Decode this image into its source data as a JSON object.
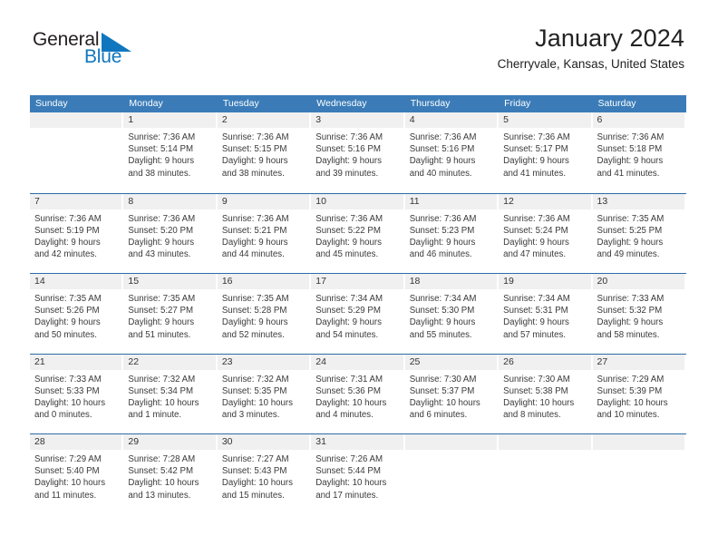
{
  "brand": {
    "name_part1": "General",
    "name_part2": "Blue",
    "triangle_icon": "triangle-icon",
    "colors": {
      "dark": "#231f20",
      "blue": "#1077bf"
    }
  },
  "header": {
    "title": "January 2024",
    "subtitle": "Cherryvale, Kansas, United States"
  },
  "theme": {
    "header_blue": "#3b7cb8",
    "row_border_blue": "#2c6ca8",
    "day_band_gray": "#f0f0f0"
  },
  "weekdays": [
    "Sunday",
    "Monday",
    "Tuesday",
    "Wednesday",
    "Thursday",
    "Friday",
    "Saturday"
  ],
  "weeks": [
    [
      {
        "day": "",
        "sunrise": "",
        "sunset": "",
        "daylight_line1": "",
        "daylight_line2": "",
        "empty": true
      },
      {
        "day": "1",
        "sunrise": "Sunrise: 7:36 AM",
        "sunset": "Sunset: 5:14 PM",
        "daylight_line1": "Daylight: 9 hours",
        "daylight_line2": "and 38 minutes."
      },
      {
        "day": "2",
        "sunrise": "Sunrise: 7:36 AM",
        "sunset": "Sunset: 5:15 PM",
        "daylight_line1": "Daylight: 9 hours",
        "daylight_line2": "and 38 minutes."
      },
      {
        "day": "3",
        "sunrise": "Sunrise: 7:36 AM",
        "sunset": "Sunset: 5:16 PM",
        "daylight_line1": "Daylight: 9 hours",
        "daylight_line2": "and 39 minutes."
      },
      {
        "day": "4",
        "sunrise": "Sunrise: 7:36 AM",
        "sunset": "Sunset: 5:16 PM",
        "daylight_line1": "Daylight: 9 hours",
        "daylight_line2": "and 40 minutes."
      },
      {
        "day": "5",
        "sunrise": "Sunrise: 7:36 AM",
        "sunset": "Sunset: 5:17 PM",
        "daylight_line1": "Daylight: 9 hours",
        "daylight_line2": "and 41 minutes."
      },
      {
        "day": "6",
        "sunrise": "Sunrise: 7:36 AM",
        "sunset": "Sunset: 5:18 PM",
        "daylight_line1": "Daylight: 9 hours",
        "daylight_line2": "and 41 minutes."
      }
    ],
    [
      {
        "day": "7",
        "sunrise": "Sunrise: 7:36 AM",
        "sunset": "Sunset: 5:19 PM",
        "daylight_line1": "Daylight: 9 hours",
        "daylight_line2": "and 42 minutes."
      },
      {
        "day": "8",
        "sunrise": "Sunrise: 7:36 AM",
        "sunset": "Sunset: 5:20 PM",
        "daylight_line1": "Daylight: 9 hours",
        "daylight_line2": "and 43 minutes."
      },
      {
        "day": "9",
        "sunrise": "Sunrise: 7:36 AM",
        "sunset": "Sunset: 5:21 PM",
        "daylight_line1": "Daylight: 9 hours",
        "daylight_line2": "and 44 minutes."
      },
      {
        "day": "10",
        "sunrise": "Sunrise: 7:36 AM",
        "sunset": "Sunset: 5:22 PM",
        "daylight_line1": "Daylight: 9 hours",
        "daylight_line2": "and 45 minutes."
      },
      {
        "day": "11",
        "sunrise": "Sunrise: 7:36 AM",
        "sunset": "Sunset: 5:23 PM",
        "daylight_line1": "Daylight: 9 hours",
        "daylight_line2": "and 46 minutes."
      },
      {
        "day": "12",
        "sunrise": "Sunrise: 7:36 AM",
        "sunset": "Sunset: 5:24 PM",
        "daylight_line1": "Daylight: 9 hours",
        "daylight_line2": "and 47 minutes."
      },
      {
        "day": "13",
        "sunrise": "Sunrise: 7:35 AM",
        "sunset": "Sunset: 5:25 PM",
        "daylight_line1": "Daylight: 9 hours",
        "daylight_line2": "and 49 minutes."
      }
    ],
    [
      {
        "day": "14",
        "sunrise": "Sunrise: 7:35 AM",
        "sunset": "Sunset: 5:26 PM",
        "daylight_line1": "Daylight: 9 hours",
        "daylight_line2": "and 50 minutes."
      },
      {
        "day": "15",
        "sunrise": "Sunrise: 7:35 AM",
        "sunset": "Sunset: 5:27 PM",
        "daylight_line1": "Daylight: 9 hours",
        "daylight_line2": "and 51 minutes."
      },
      {
        "day": "16",
        "sunrise": "Sunrise: 7:35 AM",
        "sunset": "Sunset: 5:28 PM",
        "daylight_line1": "Daylight: 9 hours",
        "daylight_line2": "and 52 minutes."
      },
      {
        "day": "17",
        "sunrise": "Sunrise: 7:34 AM",
        "sunset": "Sunset: 5:29 PM",
        "daylight_line1": "Daylight: 9 hours",
        "daylight_line2": "and 54 minutes."
      },
      {
        "day": "18",
        "sunrise": "Sunrise: 7:34 AM",
        "sunset": "Sunset: 5:30 PM",
        "daylight_line1": "Daylight: 9 hours",
        "daylight_line2": "and 55 minutes."
      },
      {
        "day": "19",
        "sunrise": "Sunrise: 7:34 AM",
        "sunset": "Sunset: 5:31 PM",
        "daylight_line1": "Daylight: 9 hours",
        "daylight_line2": "and 57 minutes."
      },
      {
        "day": "20",
        "sunrise": "Sunrise: 7:33 AM",
        "sunset": "Sunset: 5:32 PM",
        "daylight_line1": "Daylight: 9 hours",
        "daylight_line2": "and 58 minutes."
      }
    ],
    [
      {
        "day": "21",
        "sunrise": "Sunrise: 7:33 AM",
        "sunset": "Sunset: 5:33 PM",
        "daylight_line1": "Daylight: 10 hours",
        "daylight_line2": "and 0 minutes."
      },
      {
        "day": "22",
        "sunrise": "Sunrise: 7:32 AM",
        "sunset": "Sunset: 5:34 PM",
        "daylight_line1": "Daylight: 10 hours",
        "daylight_line2": "and 1 minute."
      },
      {
        "day": "23",
        "sunrise": "Sunrise: 7:32 AM",
        "sunset": "Sunset: 5:35 PM",
        "daylight_line1": "Daylight: 10 hours",
        "daylight_line2": "and 3 minutes."
      },
      {
        "day": "24",
        "sunrise": "Sunrise: 7:31 AM",
        "sunset": "Sunset: 5:36 PM",
        "daylight_line1": "Daylight: 10 hours",
        "daylight_line2": "and 4 minutes."
      },
      {
        "day": "25",
        "sunrise": "Sunrise: 7:30 AM",
        "sunset": "Sunset: 5:37 PM",
        "daylight_line1": "Daylight: 10 hours",
        "daylight_line2": "and 6 minutes."
      },
      {
        "day": "26",
        "sunrise": "Sunrise: 7:30 AM",
        "sunset": "Sunset: 5:38 PM",
        "daylight_line1": "Daylight: 10 hours",
        "daylight_line2": "and 8 minutes."
      },
      {
        "day": "27",
        "sunrise": "Sunrise: 7:29 AM",
        "sunset": "Sunset: 5:39 PM",
        "daylight_line1": "Daylight: 10 hours",
        "daylight_line2": "and 10 minutes."
      }
    ],
    [
      {
        "day": "28",
        "sunrise": "Sunrise: 7:29 AM",
        "sunset": "Sunset: 5:40 PM",
        "daylight_line1": "Daylight: 10 hours",
        "daylight_line2": "and 11 minutes."
      },
      {
        "day": "29",
        "sunrise": "Sunrise: 7:28 AM",
        "sunset": "Sunset: 5:42 PM",
        "daylight_line1": "Daylight: 10 hours",
        "daylight_line2": "and 13 minutes."
      },
      {
        "day": "30",
        "sunrise": "Sunrise: 7:27 AM",
        "sunset": "Sunset: 5:43 PM",
        "daylight_line1": "Daylight: 10 hours",
        "daylight_line2": "and 15 minutes."
      },
      {
        "day": "31",
        "sunrise": "Sunrise: 7:26 AM",
        "sunset": "Sunset: 5:44 PM",
        "daylight_line1": "Daylight: 10 hours",
        "daylight_line2": "and 17 minutes."
      },
      {
        "day": "",
        "sunrise": "",
        "sunset": "",
        "daylight_line1": "",
        "daylight_line2": "",
        "empty": true
      },
      {
        "day": "",
        "sunrise": "",
        "sunset": "",
        "daylight_line1": "",
        "daylight_line2": "",
        "empty": true
      },
      {
        "day": "",
        "sunrise": "",
        "sunset": "",
        "daylight_line1": "",
        "daylight_line2": "",
        "empty": true
      }
    ]
  ]
}
